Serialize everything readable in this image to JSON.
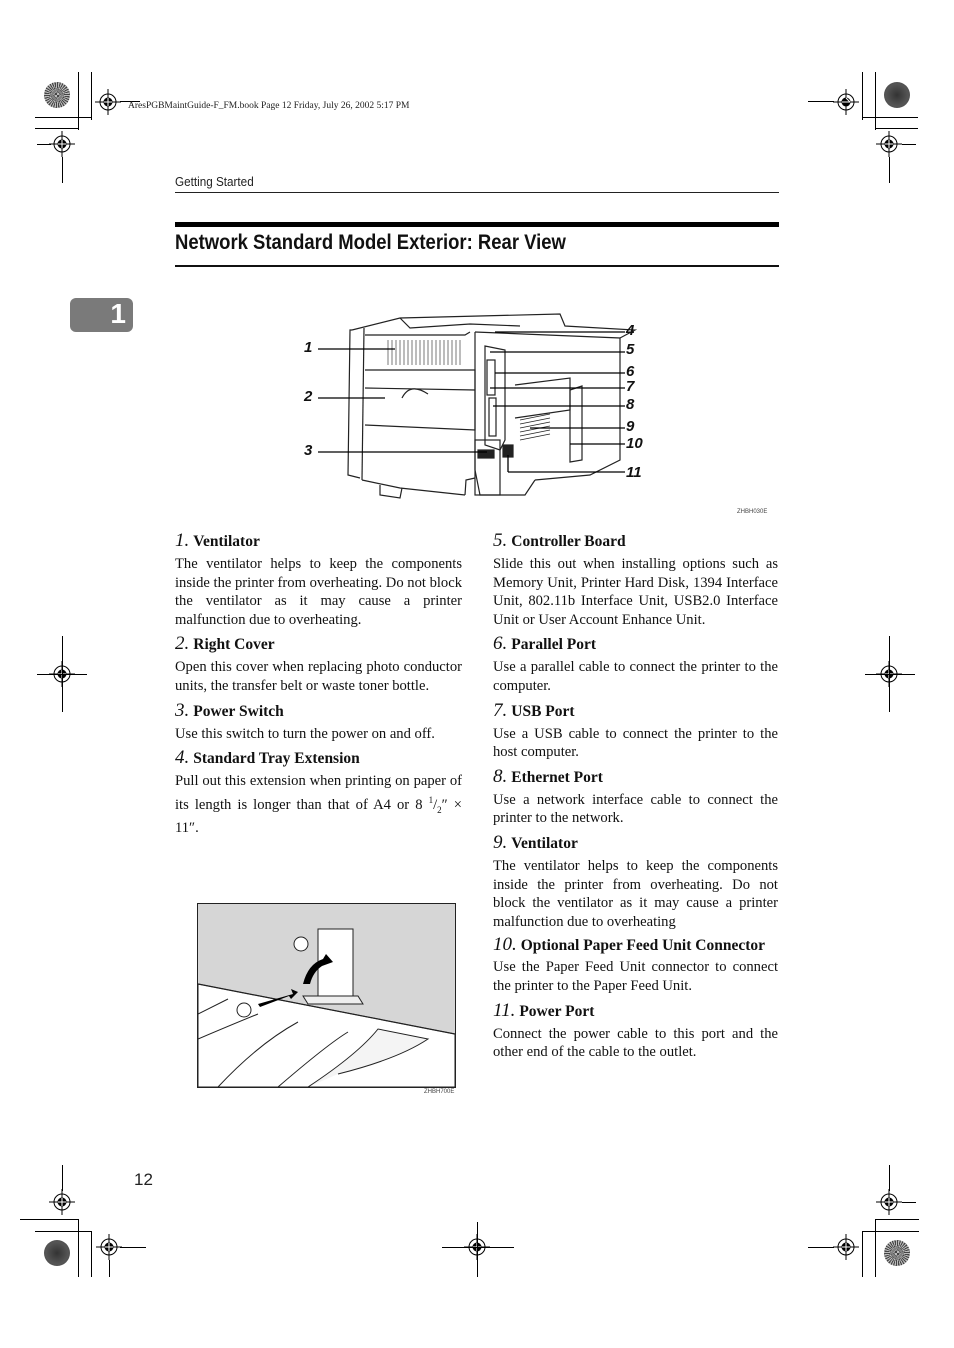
{
  "print_marks": {
    "book_info": "AresPGBMaintGuide-F_FM.book  Page 12  Friday, July 26, 2002  5:17 PM"
  },
  "header": {
    "section": "Getting Started"
  },
  "chapter_tab": "1",
  "page_title": "Network Standard Model Exterior: Rear View",
  "main_figure": {
    "icon": "printer-rear-view-illustration",
    "callouts": [
      "1",
      "2",
      "3",
      "4",
      "5",
      "6",
      "7",
      "8",
      "9",
      "10",
      "11"
    ],
    "figure_code": "ZHBH030E"
  },
  "items": [
    {
      "num": "1.",
      "title": "Ventilator",
      "text": "The ventilator helps to keep the components inside the printer from overheating. Do not block the ventilator as it may cause a printer malfunction due to overheating."
    },
    {
      "num": "2.",
      "title": "Right Cover",
      "text": "Open this cover when replacing photo conductor units, the transfer belt or waste toner bottle."
    },
    {
      "num": "3.",
      "title": "Power Switch",
      "text": "Use this switch to turn the power on and off."
    },
    {
      "num": "4.",
      "title": "Standard Tray Extension",
      "text_before": "Pull out this extension when printing on paper of its length is longer than that of A4 or 8 ",
      "frac_num": "1",
      "frac_den": "2",
      "text_after": "″ × 11″."
    },
    {
      "num": "5.",
      "title": "Controller Board",
      "text": "Slide this out when installing options such as Memory Unit, Printer Hard Disk, 1394 Interface Unit, 802.11b Interface Unit, USB2.0 Interface Unit or User Account Enhance Unit."
    },
    {
      "num": "6.",
      "title": "Parallel Port",
      "text": "Use a parallel cable to connect the printer to the computer."
    },
    {
      "num": "7.",
      "title": "USB Port",
      "text": "Use a USB cable to connect the printer to the host computer."
    },
    {
      "num": "8.",
      "title": "Ethernet Port",
      "text": "Use a network interface cable to connect the printer to the network."
    },
    {
      "num": "9.",
      "title": "Ventilator",
      "text": "The ventilator helps to keep the components inside the printer from overheating. Do not block the ventilator as it may cause a printer malfunction due to overheating"
    },
    {
      "num": "10.",
      "title": "Optional Paper Feed Unit Connector",
      "text": "Use the Paper Feed Unit connector to connect the printer to the Paper Feed Unit."
    },
    {
      "num": "11.",
      "title": "Power Port",
      "text": "Connect the power cable to this port and the other end of the cable to the outlet."
    }
  ],
  "inset_figure": {
    "icon": "tray-extension-illustration",
    "step1": "①",
    "step2": "②",
    "figure_code": "ZHBH700E"
  },
  "page_number": "12"
}
